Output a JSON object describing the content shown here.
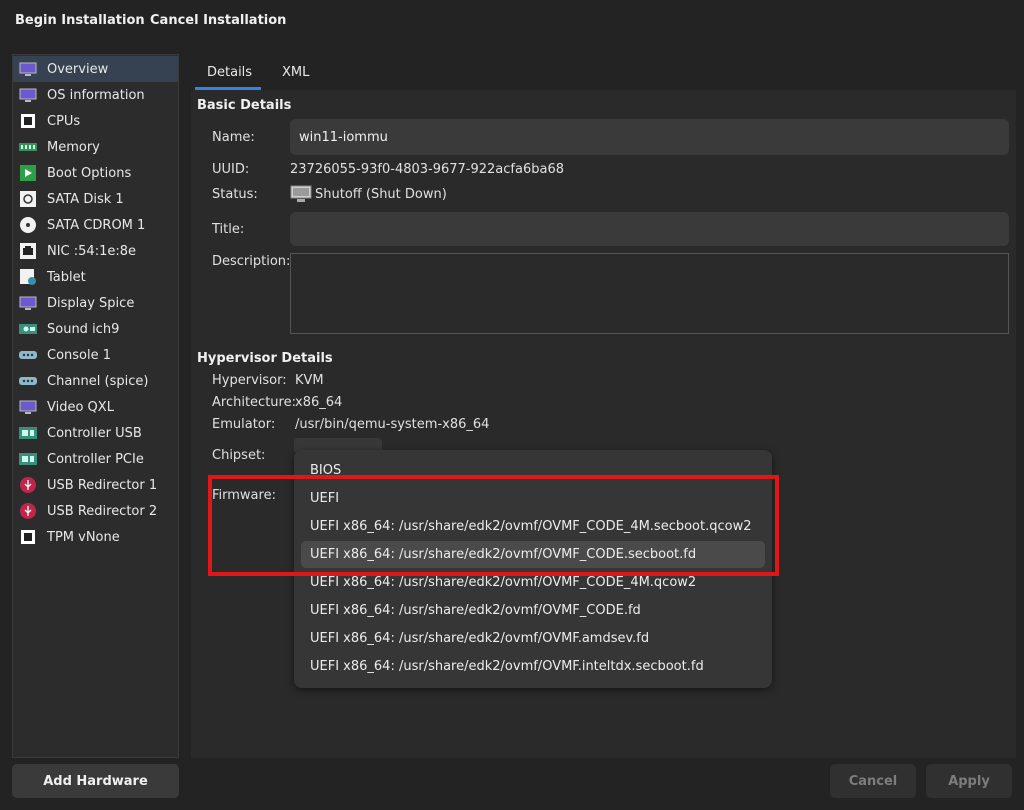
{
  "toolbar": {
    "begin_label": "Begin Installation",
    "cancel_label": "Cancel Installation"
  },
  "sidebar": {
    "items": [
      {
        "label": "Overview",
        "icon": "monitor-icon",
        "selected": true
      },
      {
        "label": "OS information",
        "icon": "monitor-icon"
      },
      {
        "label": "CPUs",
        "icon": "cpu-icon"
      },
      {
        "label": "Memory",
        "icon": "memory-icon"
      },
      {
        "label": "Boot Options",
        "icon": "boot-icon"
      },
      {
        "label": "SATA Disk 1",
        "icon": "disk-icon"
      },
      {
        "label": "SATA CDROM 1",
        "icon": "cdrom-icon"
      },
      {
        "label": "NIC :54:1e:8e",
        "icon": "network-icon"
      },
      {
        "label": "Tablet",
        "icon": "tablet-icon"
      },
      {
        "label": "Display Spice",
        "icon": "display-icon"
      },
      {
        "label": "Sound ich9",
        "icon": "sound-card-icon"
      },
      {
        "label": "Console 1",
        "icon": "serial-port-icon"
      },
      {
        "label": "Channel (spice)",
        "icon": "serial-port-icon"
      },
      {
        "label": "Video QXL",
        "icon": "monitor-icon"
      },
      {
        "label": "Controller USB",
        "icon": "controller-icon"
      },
      {
        "label": "Controller PCIe",
        "icon": "controller-icon"
      },
      {
        "label": "USB Redirector 1",
        "icon": "usb-icon"
      },
      {
        "label": "USB Redirector 2",
        "icon": "usb-icon"
      },
      {
        "label": "TPM vNone",
        "icon": "tpm-icon"
      }
    ],
    "add_hardware_label": "Add Hardware"
  },
  "tabs": {
    "details": "Details",
    "xml": "XML"
  },
  "basic": {
    "title": "Basic Details",
    "name_label": "Name:",
    "name_value": "win11-iommu",
    "uuid_label": "UUID:",
    "uuid_value": "23726055-93f0-4803-9677-922acfa6ba68",
    "status_label": "Status:",
    "status_value": "Shutoff (Shut Down)",
    "title_label": "Title:",
    "title_value": "",
    "description_label": "Description:",
    "description_value": ""
  },
  "hypervisor": {
    "title": "Hypervisor Details",
    "hypervisor_label": "Hypervisor:",
    "hypervisor_value": "KVM",
    "architecture_label": "Architecture:",
    "architecture_value": "x86_64",
    "emulator_label": "Emulator:",
    "emulator_value": "/usr/bin/qemu-system-x86_64",
    "chipset_label": "Chipset:",
    "firmware_label": "Firmware:"
  },
  "firmware_menu": {
    "options": [
      "BIOS",
      "UEFI",
      "UEFI x86_64: /usr/share/edk2/ovmf/OVMF_CODE_4M.secboot.qcow2",
      "UEFI x86_64: /usr/share/edk2/ovmf/OVMF_CODE.secboot.fd",
      "UEFI x86_64: /usr/share/edk2/ovmf/OVMF_CODE_4M.qcow2",
      "UEFI x86_64: /usr/share/edk2/ovmf/OVMF_CODE.fd",
      "UEFI x86_64: /usr/share/edk2/ovmf/OVMF.amdsev.fd",
      "UEFI x86_64: /usr/share/edk2/ovmf/OVMF.inteltdx.secboot.fd"
    ],
    "hovered": "UEFI x86_64: /usr/share/edk2/ovmf/OVMF_CODE.secboot.fd"
  },
  "footer": {
    "cancel_label": "Cancel",
    "apply_label": "Apply"
  },
  "colors": {
    "selection": "#364251",
    "accent": "#3584e4",
    "highlight_box": "#e11616"
  }
}
